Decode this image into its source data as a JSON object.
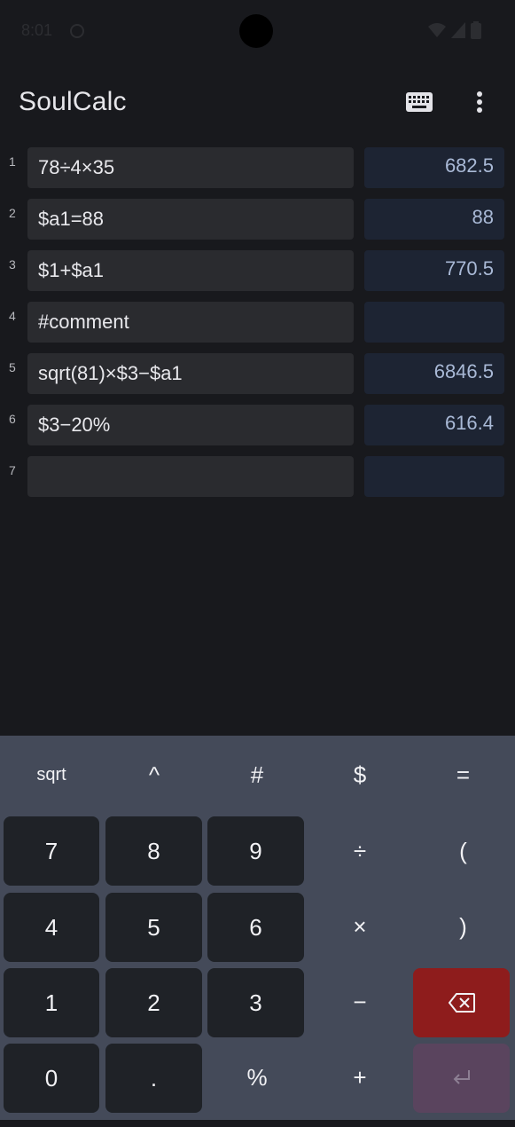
{
  "status_bar": {
    "time": "8:01",
    "icons": [
      "sync-icon",
      "wifi-icon",
      "signal-icon",
      "battery-icon"
    ]
  },
  "app_bar": {
    "title": "SoulCalc",
    "actions": [
      "keyboard-icon",
      "more-vert-icon"
    ]
  },
  "rows": [
    {
      "num": "1",
      "expr": "78÷4×35",
      "result": "682.5"
    },
    {
      "num": "2",
      "expr": "$a1=88",
      "result": "88"
    },
    {
      "num": "3",
      "expr": "$1+$a1",
      "result": "770.5"
    },
    {
      "num": "4",
      "expr": "#comment",
      "result": ""
    },
    {
      "num": "5",
      "expr": "sqrt(81)×$3−$a1",
      "result": "6846.5"
    },
    {
      "num": "6",
      "expr": "$3−20%",
      "result": "616.4"
    },
    {
      "num": "7",
      "expr": "",
      "result": ""
    }
  ],
  "keypad": {
    "sqrt": "sqrt",
    "caret": "^",
    "hash": "#",
    "dollar": "$",
    "equals": "=",
    "k7": "7",
    "k8": "8",
    "k9": "9",
    "divide": "÷",
    "lparen": "(",
    "k4": "4",
    "k5": "5",
    "k6": "6",
    "multiply": "×",
    "rparen": ")",
    "k1": "1",
    "k2": "2",
    "k3": "3",
    "minus": "−",
    "k0": "0",
    "dot": ".",
    "percent": "%",
    "plus": "+",
    "backspace_icon": "backspace-icon",
    "enter_icon": "enter-icon"
  },
  "colors": {
    "background": "#18191d",
    "input_bg": "#2a2b2f",
    "result_bg": "#1d2433",
    "result_text": "#a9b9d6",
    "keypad_bg": "#444a59",
    "number_key_bg": "#1f2227",
    "backspace_bg": "#8e1c1c",
    "enter_bg": "#5a445e"
  }
}
